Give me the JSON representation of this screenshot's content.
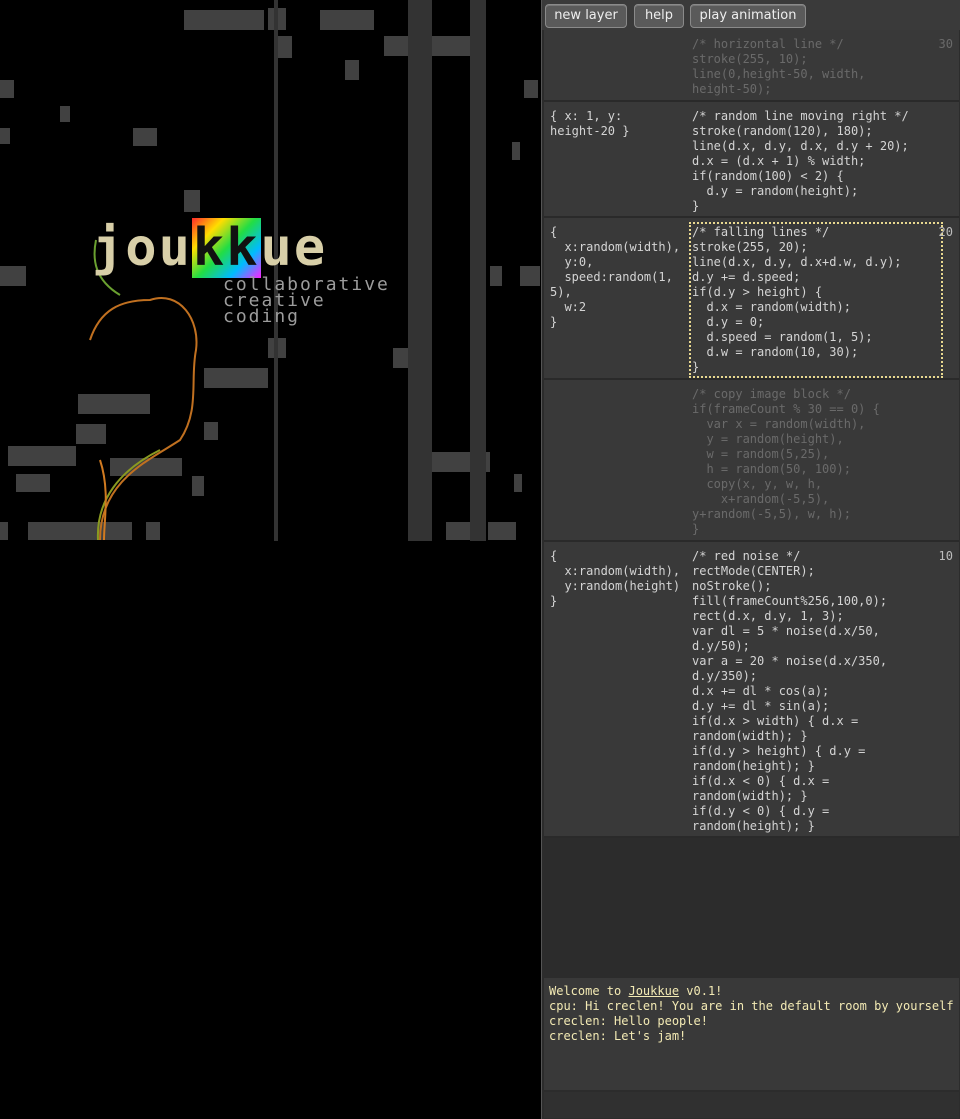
{
  "logo": {
    "pre": "jou",
    "kk": "kk",
    "post": "ue",
    "tagline": [
      "collaborative",
      "creative",
      "coding"
    ]
  },
  "toolbar": {
    "new_layer": "new layer",
    "help": "help",
    "play_animation": "play animation"
  },
  "layers": [
    {
      "state": "",
      "code": "/* horizontal line */\nstroke(255, 10);\nline(0,height-50, width,\nheight-50);",
      "num": "30",
      "dim": true
    },
    {
      "state": "{ x: 1, y:\nheight-20 }",
      "code": "/* random line moving right */\nstroke(random(120), 180);\nline(d.x, d.y, d.x, d.y + 20);\nd.x = (d.x + 1) % width;\nif(random(100) < 2) {\n  d.y = random(height);\n}",
      "num": ""
    },
    {
      "state": "{\n  x:random(width),\n  y:0,\n  speed:random(1,\n5),\n  w:2\n}",
      "code": "/* falling lines */\nstroke(255, 20);\nline(d.x, d.y, d.x+d.w, d.y);\nd.y += d.speed;\nif(d.y > height) {\n  d.x = random(width);\n  d.y = 0;\n  d.speed = random(1, 5);\n  d.w = random(10, 30);\n}",
      "num": "20",
      "active": true
    },
    {
      "state": "",
      "code": "/* copy image block */\nif(frameCount % 30 == 0) {\n  var x = random(width),\n  y = random(height),\n  w = random(5,25),\n  h = random(50, 100);\n  copy(x, y, w, h,\n    x+random(-5,5),\ny+random(-5,5), w, h);\n}",
      "num": "",
      "dim": true
    },
    {
      "state": "{\n  x:random(width),\n  y:random(height)\n}",
      "code": "/* red noise */\nrectMode(CENTER);\nnoStroke();\nfill(frameCount%256,100,0);\nrect(d.x, d.y, 1, 3);\nvar dl = 5 * noise(d.x/50,\nd.y/50);\nvar a = 20 * noise(d.x/350,\nd.y/350);\nd.x += dl * cos(a);\nd.y += dl * sin(a);\nif(d.x > width) { d.x =\nrandom(width); }\nif(d.y > height) { d.y =\nrandom(height); }\nif(d.x < 0) { d.x =\nrandom(width); }\nif(d.y < 0) { d.y =\nrandom(height); }",
      "num": "10"
    }
  ],
  "chat": {
    "welcome_pre": "Welcome to ",
    "welcome_link": "Joukkue",
    "welcome_post": " v0.1!",
    "messages": [
      "cpu: Hi creclen! You are in the default room by yourself",
      "creclen: Hello people!",
      "creclen: Let's jam!"
    ]
  }
}
